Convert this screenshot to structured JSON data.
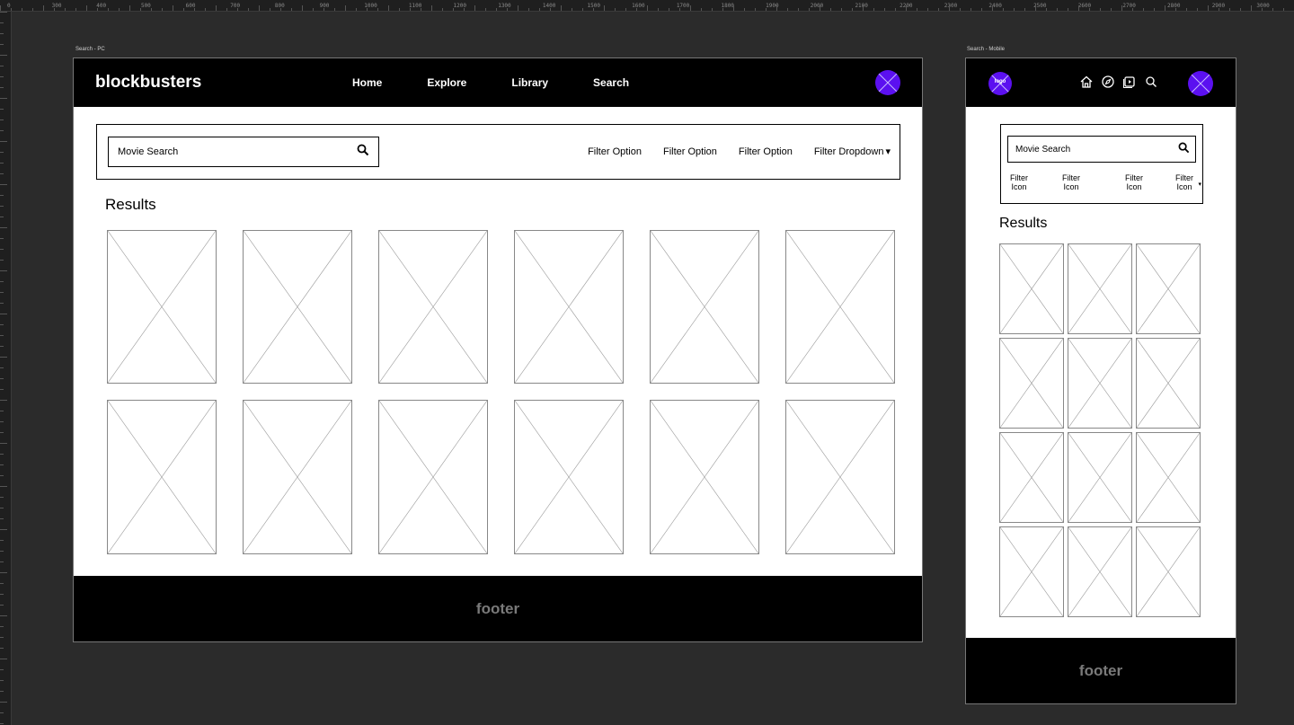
{
  "ruler": {
    "top_labels": [
      "0",
      "300",
      "400",
      "500",
      "600",
      "700",
      "800",
      "900",
      "1000",
      "1100",
      "1200",
      "1300",
      "1400",
      "1500",
      "1600",
      "1700",
      "1800",
      "1900",
      "2000",
      "2100",
      "2200",
      "2300",
      "2400",
      "2500",
      "2600",
      "2700",
      "2800",
      "2900",
      "3000"
    ]
  },
  "pc": {
    "artboard_label": "Search - PC",
    "logo": "blockbusters",
    "nav": [
      "Home",
      "Explore",
      "Library",
      "Search"
    ],
    "search_placeholder": "Movie Search",
    "filters": [
      "Filter Option",
      "Filter Option",
      "Filter Option"
    ],
    "dropdown_label": "Filter Dropdown",
    "dropdown_caret": "▾",
    "results_title": "Results",
    "result_count": 12,
    "footer": "footer"
  },
  "mobile": {
    "artboard_label": "Search - Mobile",
    "logo": "logo",
    "nav_icons": [
      "home-icon",
      "compass-icon",
      "library-icon",
      "search-icon"
    ],
    "search_placeholder": "Movie Search",
    "filters": [
      "Filter Icon",
      "Filter Icon",
      "Filter Icon",
      "Filter Icon"
    ],
    "dropdown_caret": "▾",
    "results_title": "Results",
    "result_count": 12,
    "footer": "footer"
  },
  "colors": {
    "canvas": "#2b2b2b",
    "header": "#000000",
    "accent": "#5b10f0",
    "footer_text": "#7a7a7a"
  }
}
